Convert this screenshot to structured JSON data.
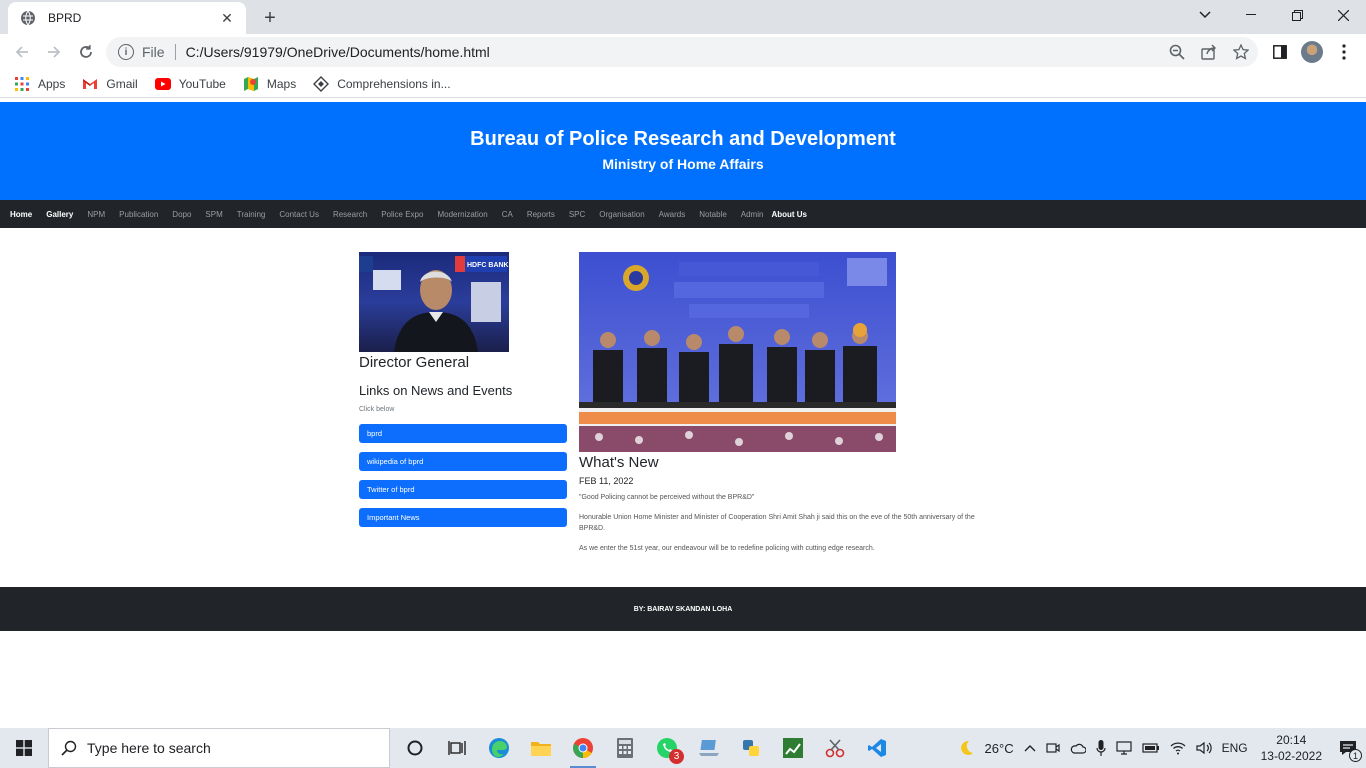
{
  "browser": {
    "tab_title": "BPRD",
    "url_scheme": "File",
    "url": "C:/Users/91979/OneDrive/Documents/home.html",
    "bookmarks": [
      {
        "label": "Apps",
        "icon": "apps-grid-icon"
      },
      {
        "label": "Gmail",
        "icon": "gmail-icon"
      },
      {
        "label": "YouTube",
        "icon": "youtube-icon"
      },
      {
        "label": "Maps",
        "icon": "maps-icon"
      },
      {
        "label": "Comprehensions in...",
        "icon": "bookmark-site-icon"
      }
    ]
  },
  "site": {
    "title": "Bureau of Police Research and Development",
    "subtitle": "Ministry of Home Affairs",
    "nav": [
      {
        "label": "Home",
        "active": true
      },
      {
        "label": "Gallery",
        "active": true
      },
      {
        "label": "NPM",
        "active": false
      },
      {
        "label": "Publication",
        "active": false
      },
      {
        "label": "Dopo",
        "active": false
      },
      {
        "label": "SPM",
        "active": false
      },
      {
        "label": "Training",
        "active": false
      },
      {
        "label": "Contact Us",
        "active": false
      },
      {
        "label": "Research",
        "active": false
      },
      {
        "label": "Police Expo",
        "active": false
      },
      {
        "label": "Modernization",
        "active": false
      },
      {
        "label": "CA",
        "active": false
      },
      {
        "label": "Reports",
        "active": false
      },
      {
        "label": "SPC",
        "active": false
      },
      {
        "label": "Organisation",
        "active": false
      },
      {
        "label": "Awards",
        "active": false
      },
      {
        "label": "Notable",
        "active": false
      },
      {
        "label": "Admin",
        "active": false
      },
      {
        "label": "About Us",
        "active": true
      }
    ],
    "director": {
      "heading": "Director General",
      "photo_banner_text": "HDFC BANK"
    },
    "links": {
      "heading": "Links on News and Events",
      "hint": "Click below",
      "items": [
        "bprd",
        "wikipedia of bprd",
        "Twitter of bprd",
        "Important News"
      ]
    },
    "whats_new": {
      "heading": "What's New",
      "date": "FEB 11, 2022",
      "quote": "\"Good Policing cannot be perceived without the BPR&D\"",
      "para1": "Honurable Union Home Minister and Minister of Cooperation Shri Amit Shah ji said this on the eve of the 50th anniversary of the BPR&D.",
      "para2": "As we enter the 51st year, our endeavour will be to redefine policing with cutting edge research."
    },
    "footer": "BY: BAIRAV SKANDAN LOHA"
  },
  "taskbar": {
    "search_placeholder": "Type here to search",
    "whatsapp_badge": "3",
    "weather": "26°C",
    "language": "ENG",
    "time": "20:14",
    "date": "13-02-2022",
    "notification_count": "1"
  },
  "colors": {
    "hero_blue": "#0070ff",
    "nav_dark": "#212529",
    "link_button": "#0d6efd"
  }
}
